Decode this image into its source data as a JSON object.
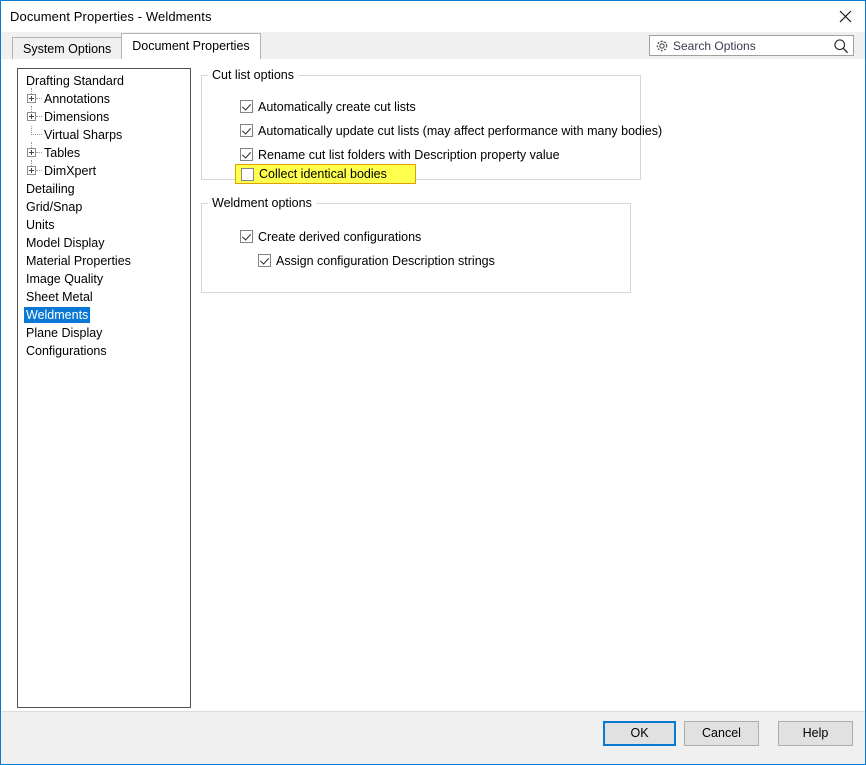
{
  "window": {
    "title": "Document Properties - Weldments",
    "close_icon": "close-icon"
  },
  "tabs": [
    {
      "label": "System Options",
      "active": false
    },
    {
      "label": "Document Properties",
      "active": true
    }
  ],
  "search": {
    "placeholder": "Search Options",
    "gear_icon": "gear-icon",
    "search_icon": "search-icon"
  },
  "tree": {
    "items": [
      {
        "label": "Drafting Standard",
        "indent": 0,
        "expander": "none",
        "selected": false
      },
      {
        "label": "Annotations",
        "indent": 1,
        "expander": "plus",
        "selected": false
      },
      {
        "label": "Dimensions",
        "indent": 1,
        "expander": "plus",
        "selected": false
      },
      {
        "label": "Virtual Sharps",
        "indent": 1,
        "expander": "leaf",
        "selected": false
      },
      {
        "label": "Tables",
        "indent": 1,
        "expander": "plus",
        "selected": false
      },
      {
        "label": "DimXpert",
        "indent": 1,
        "expander": "plus",
        "selected": false
      },
      {
        "label": "Detailing",
        "indent": 0,
        "expander": "none",
        "selected": false
      },
      {
        "label": "Grid/Snap",
        "indent": 0,
        "expander": "none",
        "selected": false
      },
      {
        "label": "Units",
        "indent": 0,
        "expander": "none",
        "selected": false
      },
      {
        "label": "Model Display",
        "indent": 0,
        "expander": "none",
        "selected": false
      },
      {
        "label": "Material Properties",
        "indent": 0,
        "expander": "none",
        "selected": false
      },
      {
        "label": "Image Quality",
        "indent": 0,
        "expander": "none",
        "selected": false
      },
      {
        "label": "Sheet Metal",
        "indent": 0,
        "expander": "none",
        "selected": false
      },
      {
        "label": "Weldments",
        "indent": 0,
        "expander": "none",
        "selected": true
      },
      {
        "label": "Plane Display",
        "indent": 0,
        "expander": "none",
        "selected": false
      },
      {
        "label": "Configurations",
        "indent": 0,
        "expander": "none",
        "selected": false
      }
    ]
  },
  "groups": {
    "cut_list": {
      "legend": "Cut list options",
      "options": [
        {
          "label": "Automatically create cut lists",
          "checked": true,
          "highlighted": false
        },
        {
          "label": "Automatically update cut lists (may affect performance with many bodies)",
          "checked": true,
          "highlighted": false
        },
        {
          "label": "Rename cut list folders with Description property value",
          "checked": true,
          "highlighted": false
        },
        {
          "label": "Collect identical bodies",
          "checked": false,
          "highlighted": true
        }
      ]
    },
    "weldment": {
      "legend": "Weldment options",
      "options": [
        {
          "label": "Create derived configurations",
          "checked": true,
          "highlighted": false
        },
        {
          "label": "Assign configuration Description strings",
          "checked": true,
          "highlighted": false
        }
      ]
    }
  },
  "footer": {
    "ok": "OK",
    "cancel": "Cancel",
    "help": "Help"
  },
  "colors": {
    "accent": "#0a78d4",
    "highlight": "#ffff4d",
    "highlight_border": "#e0a000",
    "window_border": "#0a7ad1",
    "footer_bg": "#f0f0f0"
  }
}
